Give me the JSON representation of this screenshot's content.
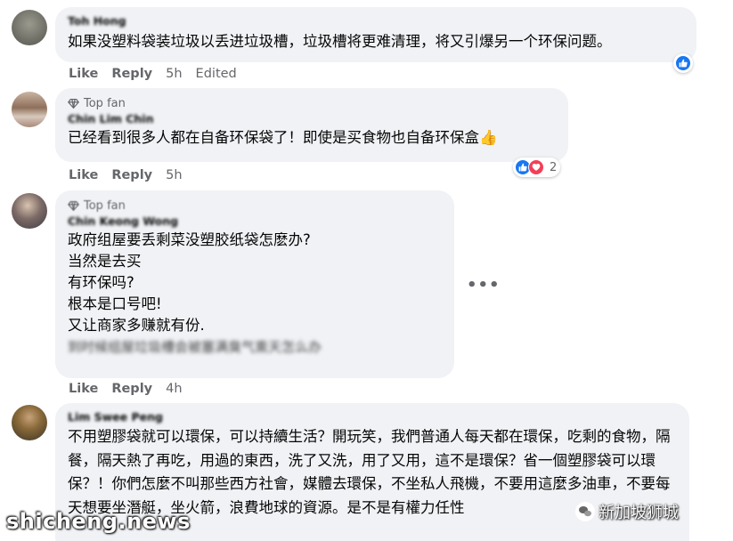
{
  "comments": [
    {
      "author": "Toh Hong",
      "text": "如果没塑料袋装垃圾以丢进垃圾槽，垃圾槽将更难清理，将又引爆另一个环保问题。",
      "like": "Like",
      "reply": "Reply",
      "time": "5h",
      "edited": "Edited"
    },
    {
      "badge": "Top fan",
      "author": "Chin Lim Chin",
      "text": "已经看到很多人都在自备环保袋了！即使是买食物也自备环保盒👍",
      "like": "Like",
      "reply": "Reply",
      "time": "5h",
      "reaction_count": "2"
    },
    {
      "badge": "Top fan",
      "author": "Chin Keong Wong",
      "lines": [
        "政府组屋要丢剩菜没塑胶纸袋怎麽办?",
        "当然是去买",
        "有环保吗?",
        "根本是口号吧!",
        "又让商家多赚就有份."
      ],
      "blurred_line": "到时候组屋垃圾槽会被塞满臭气熏天怎么办",
      "like": "Like",
      "reply": "Reply",
      "time": "4h"
    },
    {
      "author": "Lim Swee Peng",
      "text": "不用塑膠袋就可以環保，可以持續生活？開玩笑，我們普通人每天都在環保，吃剩的食物，隔餐，隔天熱了再吃，用過的東西，洗了又洗，用了又用，這不是環保？省一個塑膠袋可以環保？！你們怎麼不叫那些西方社會，媒體去環保，不坐私人飛機，不要用這麼多油車，不要每天想要坐潛艇，坐火箭，浪費地球的資源。是不是有權力任性"
    }
  ],
  "more_options": "•••",
  "watermark": "shicheng.news",
  "watermark2": "新加坡狮城"
}
